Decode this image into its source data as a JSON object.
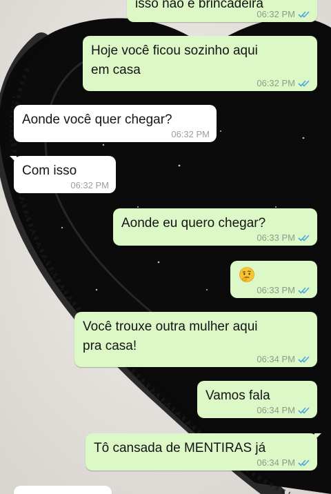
{
  "colors": {
    "outgoing_bubble": "#dcf8c6",
    "incoming_bubble": "#ffffff",
    "read_ticks": "#4fa3e0",
    "wallpaper_paper": "#e9e6e1",
    "wallpaper_heart": "#0b0b0c"
  },
  "icons": {
    "read_receipt": "double-check-icon",
    "emoji": "thinking-face-emoji"
  },
  "messages": [
    {
      "direction": "out",
      "text": "isso não é brincadeira",
      "time": "06:32 PM",
      "status": "read"
    },
    {
      "direction": "out",
      "text": "Hoje você ficou sozinho aqui\nem casa",
      "time": "06:32 PM",
      "status": "read"
    },
    {
      "direction": "in",
      "text": "Aonde você quer chegar?",
      "time": "06:32 PM"
    },
    {
      "direction": "in",
      "text": "Com isso",
      "time": "06:32 PM"
    },
    {
      "direction": "out",
      "text": "Aonde eu quero chegar?",
      "time": "06:33 PM",
      "status": "read"
    },
    {
      "direction": "out",
      "text": "🤔",
      "time": "06:33 PM",
      "status": "read"
    },
    {
      "direction": "out",
      "text": "Você trouxe outra mulher aqui\npra casa!",
      "time": "06:34 PM",
      "status": "read"
    },
    {
      "direction": "out",
      "text": "Vamos fala",
      "time": "06:34 PM",
      "status": "read"
    },
    {
      "direction": "out",
      "text": "Tô cansada de MENTIRAS já",
      "time": "06:34 PM",
      "status": "read"
    }
  ]
}
